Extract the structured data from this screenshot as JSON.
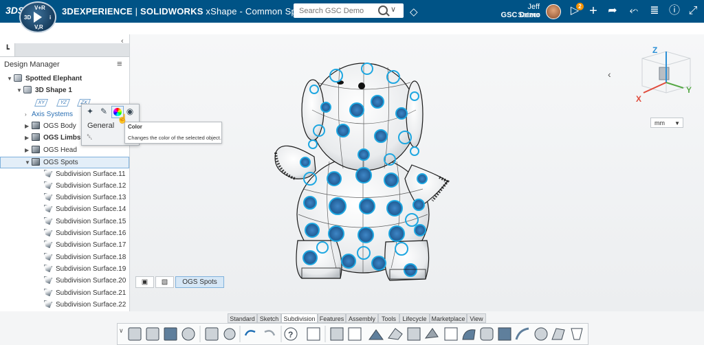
{
  "topbar": {
    "brand_logo": "3DS",
    "compass_labels": {
      "top": "V+R",
      "left": "3D",
      "right": "i",
      "bottom": "V,R"
    },
    "app_title_prefix": "3DEXPERIENCE",
    "app_title_product": "SOLIDWORKS",
    "app_title_space": "xShape - Common Space",
    "search_placeholder": "Search GSC Demo",
    "user_name": "Jeff Setzer",
    "user_company": "GSC Demo",
    "notification_count": "2",
    "icons": [
      "tag-icon",
      "notifications-icon",
      "add-icon",
      "share-icon",
      "community-icon",
      "apps-icon",
      "help-icon",
      "expand-icon"
    ]
  },
  "left_panel": {
    "title": "Design Manager",
    "tree": [
      {
        "label": "Spotted Elephant",
        "bold": true
      },
      {
        "label": "3D Shape 1",
        "bold": true
      },
      {
        "label": "Axis Systems",
        "bold": false
      },
      {
        "label": "OGS Body",
        "bold": false
      },
      {
        "label": "OGS Limbs",
        "bold": true
      },
      {
        "label": "OGS Head",
        "bold": false
      },
      {
        "label": "OGS Spots",
        "bold": false
      },
      {
        "label": "Subdivision Surface.11"
      },
      {
        "label": "Subdivision Surface.12"
      },
      {
        "label": "Subdivision Surface.13"
      },
      {
        "label": "Subdivision Surface.14"
      },
      {
        "label": "Subdivision Surface.15"
      },
      {
        "label": "Subdivision Surface.16"
      },
      {
        "label": "Subdivision Surface.17"
      },
      {
        "label": "Subdivision Surface.18"
      },
      {
        "label": "Subdivision Surface.19"
      },
      {
        "label": "Subdivision Surface.20"
      },
      {
        "label": "Subdivision Surface.21"
      },
      {
        "label": "Subdivision Surface.22"
      }
    ],
    "plane_labels": [
      "XY",
      "YZ",
      "ZX"
    ]
  },
  "context_menu": {
    "section_label": "General",
    "tooltip_title": "Color",
    "tooltip_description": "Changes the color of the selected object."
  },
  "viewport": {
    "units": "mm",
    "axis_labels": {
      "x": "X",
      "y": "Y",
      "z": "Z"
    },
    "breadcrumb_active": "OGS Spots"
  },
  "bottom_tabs": {
    "items": [
      "Standard",
      "Sketch",
      "Subdivision",
      "Features",
      "Assembly",
      "Tools",
      "Lifecycle",
      "Marketplace",
      "View"
    ],
    "active": "Subdivision"
  },
  "colors": {
    "topbar": "#005386",
    "spot_outline": "#1ea7e1",
    "spot_fill": "#2d6fb0",
    "selection": "#e3eef8"
  }
}
